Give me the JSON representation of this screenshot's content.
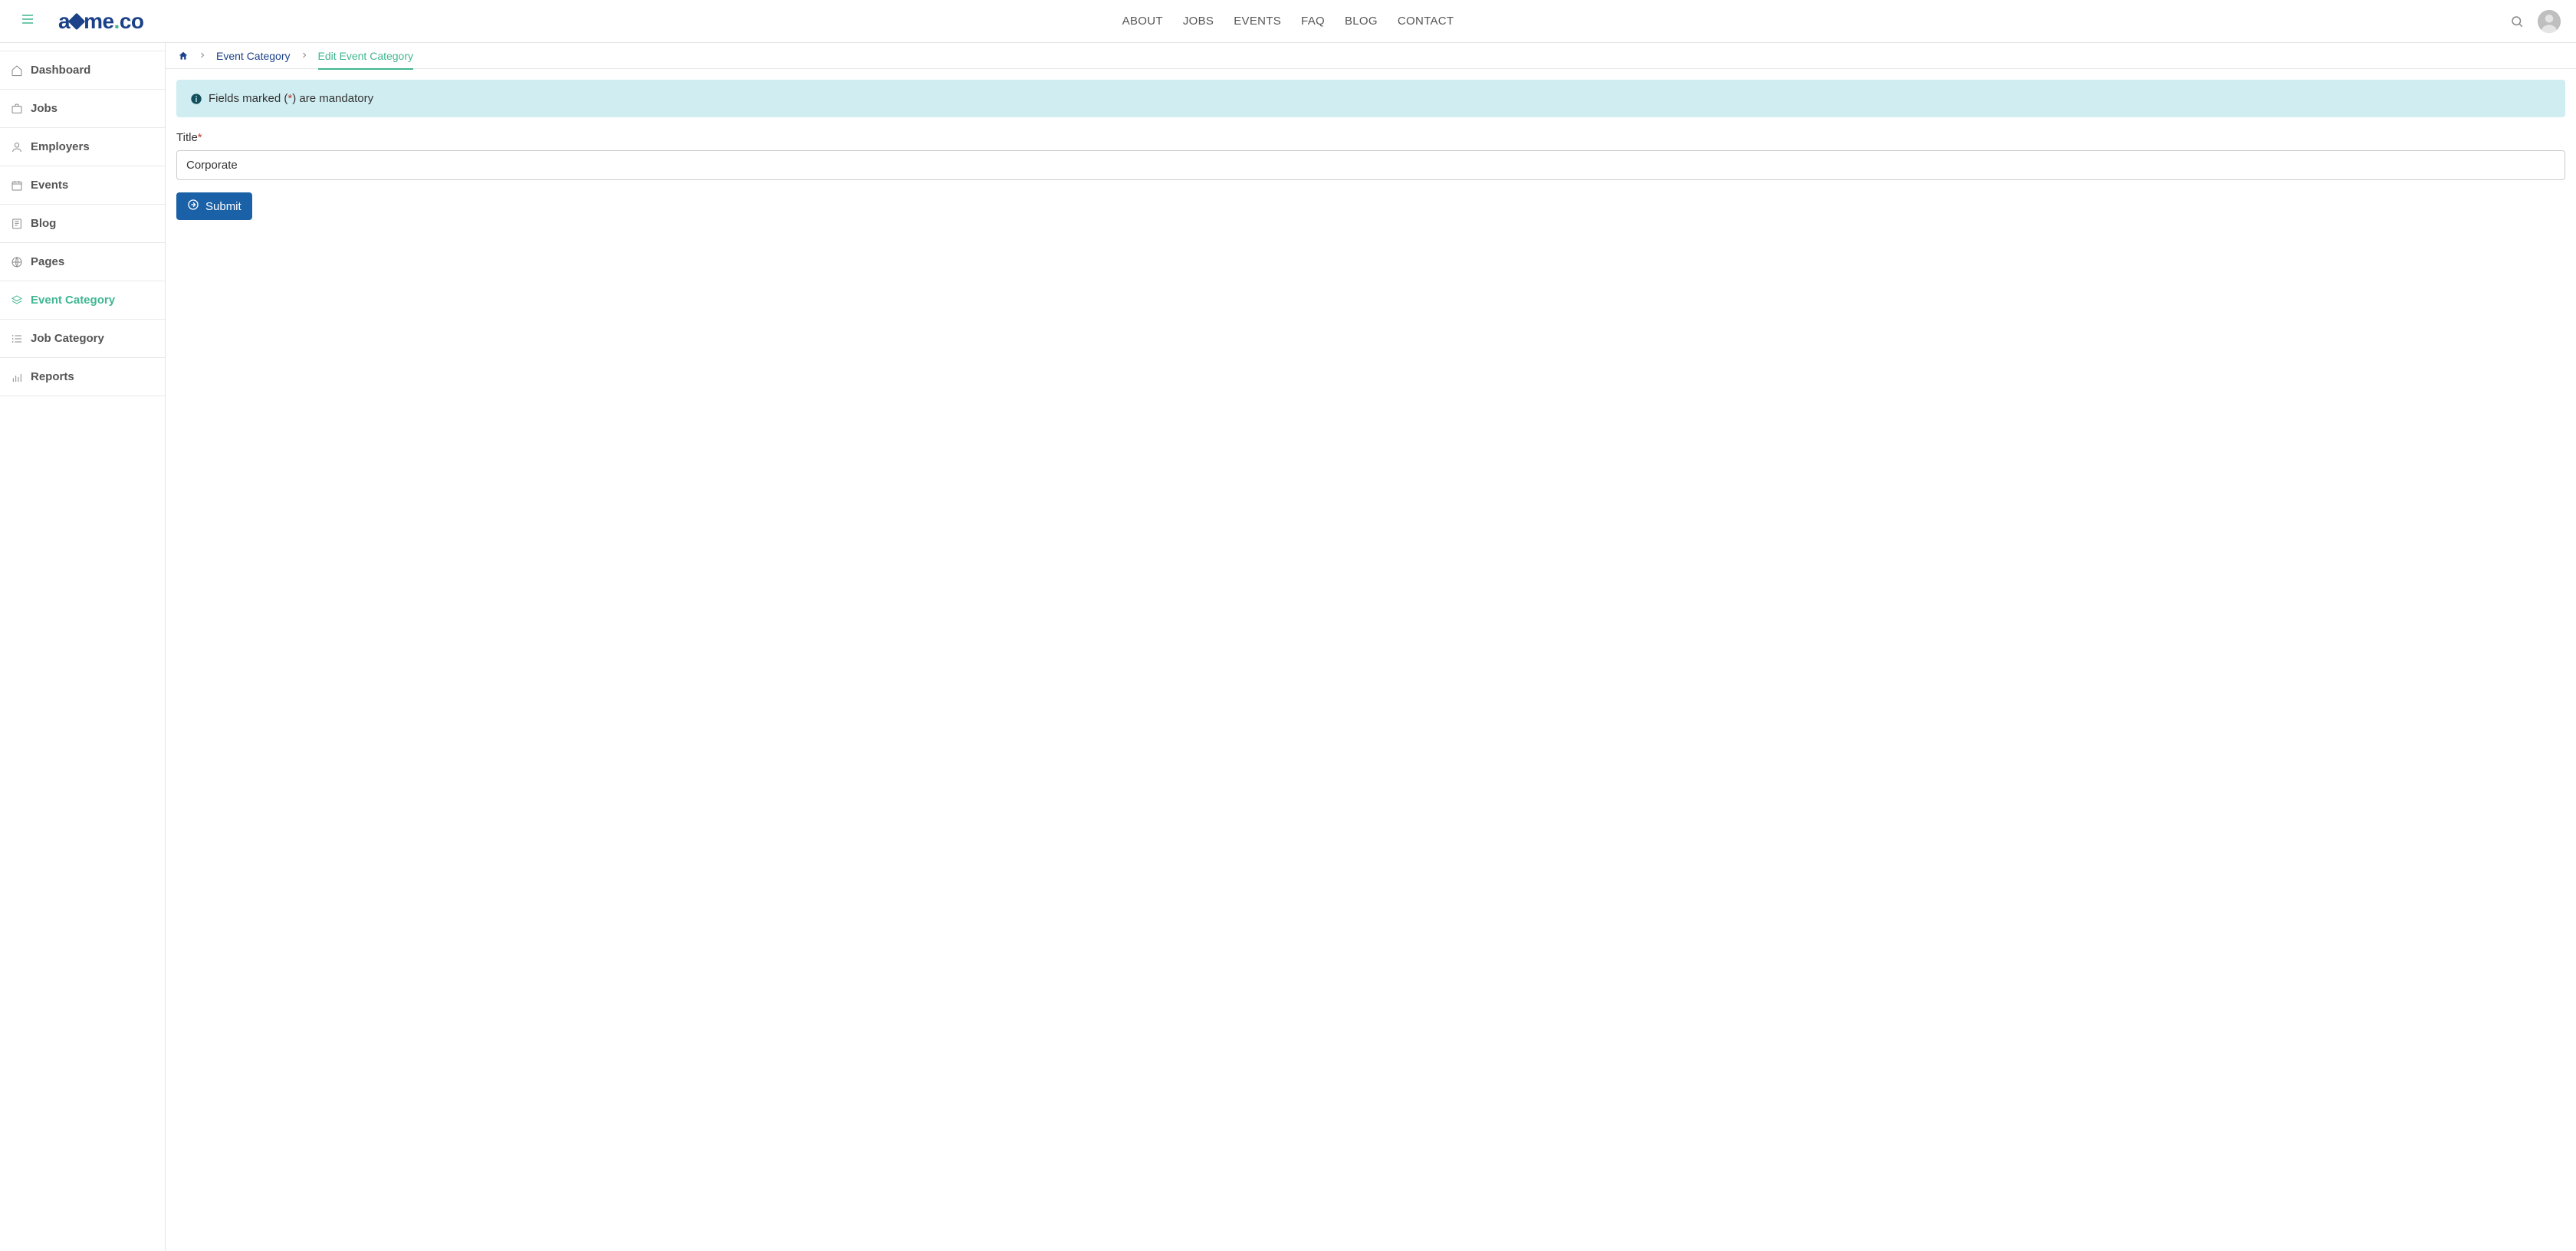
{
  "header": {
    "logo_prefix": "a",
    "logo_mid": "me",
    "logo_suffix": "co",
    "nav": [
      {
        "label": "ABOUT"
      },
      {
        "label": "JOBS"
      },
      {
        "label": "EVENTS"
      },
      {
        "label": "FAQ"
      },
      {
        "label": "BLOG"
      },
      {
        "label": "CONTACT"
      }
    ]
  },
  "sidebar": {
    "items": [
      {
        "label": "Dashboard",
        "icon": "home-icon",
        "active": false
      },
      {
        "label": "Jobs",
        "icon": "briefcase-icon",
        "active": false
      },
      {
        "label": "Employers",
        "icon": "user-icon",
        "active": false
      },
      {
        "label": "Events",
        "icon": "calendar-icon",
        "active": false
      },
      {
        "label": "Blog",
        "icon": "book-icon",
        "active": false
      },
      {
        "label": "Pages",
        "icon": "globe-icon",
        "active": false
      },
      {
        "label": "Event Category",
        "icon": "layers-icon",
        "active": true
      },
      {
        "label": "Job Category",
        "icon": "list-icon",
        "active": false
      },
      {
        "label": "Reports",
        "icon": "chart-icon",
        "active": false
      }
    ]
  },
  "breadcrumb": {
    "parent": "Event Category",
    "current": "Edit Event Category"
  },
  "alert": {
    "prefix": "Fields marked (",
    "star": "*",
    "suffix": ") are mandatory"
  },
  "form": {
    "title_label": "Title",
    "title_value": "Corporate",
    "submit_label": "Submit"
  }
}
